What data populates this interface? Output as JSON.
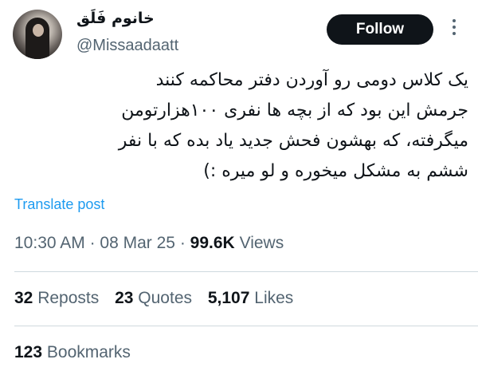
{
  "author": {
    "display_name": "خانوم فَلَق",
    "handle": "@Missaadaatt",
    "avatar_icon": "avatar-photo"
  },
  "follow_label": "Follow",
  "more_icon": "more-options-icon",
  "tweet": {
    "lines": [
      "یک کلاس دومی رو آوردن دفتر محاکمه کنند",
      "جرمش این بود که از بچه ها نفری ۱۰۰هزارتومن",
      "میگرفته، که  بهشون فحش جدید یاد بده که با نفر",
      "ششم به مشکل میخوره و لو میره :)"
    ]
  },
  "translate_label": "Translate post",
  "meta": {
    "time": "10:30 AM",
    "date": "08 Mar 25",
    "views_count": "99.6K",
    "views_label": "Views",
    "separator": "·"
  },
  "stats": {
    "reposts_count": "32",
    "reposts_label": "Reposts",
    "quotes_count": "23",
    "quotes_label": "Quotes",
    "likes_count": "5,107",
    "likes_label": "Likes",
    "bookmarks_count": "123",
    "bookmarks_label": "Bookmarks"
  },
  "colors": {
    "text": "#0f1419",
    "secondary": "#536471",
    "link": "#1d9bf0",
    "divider": "#cfd9de",
    "button_bg": "#0f1419"
  }
}
